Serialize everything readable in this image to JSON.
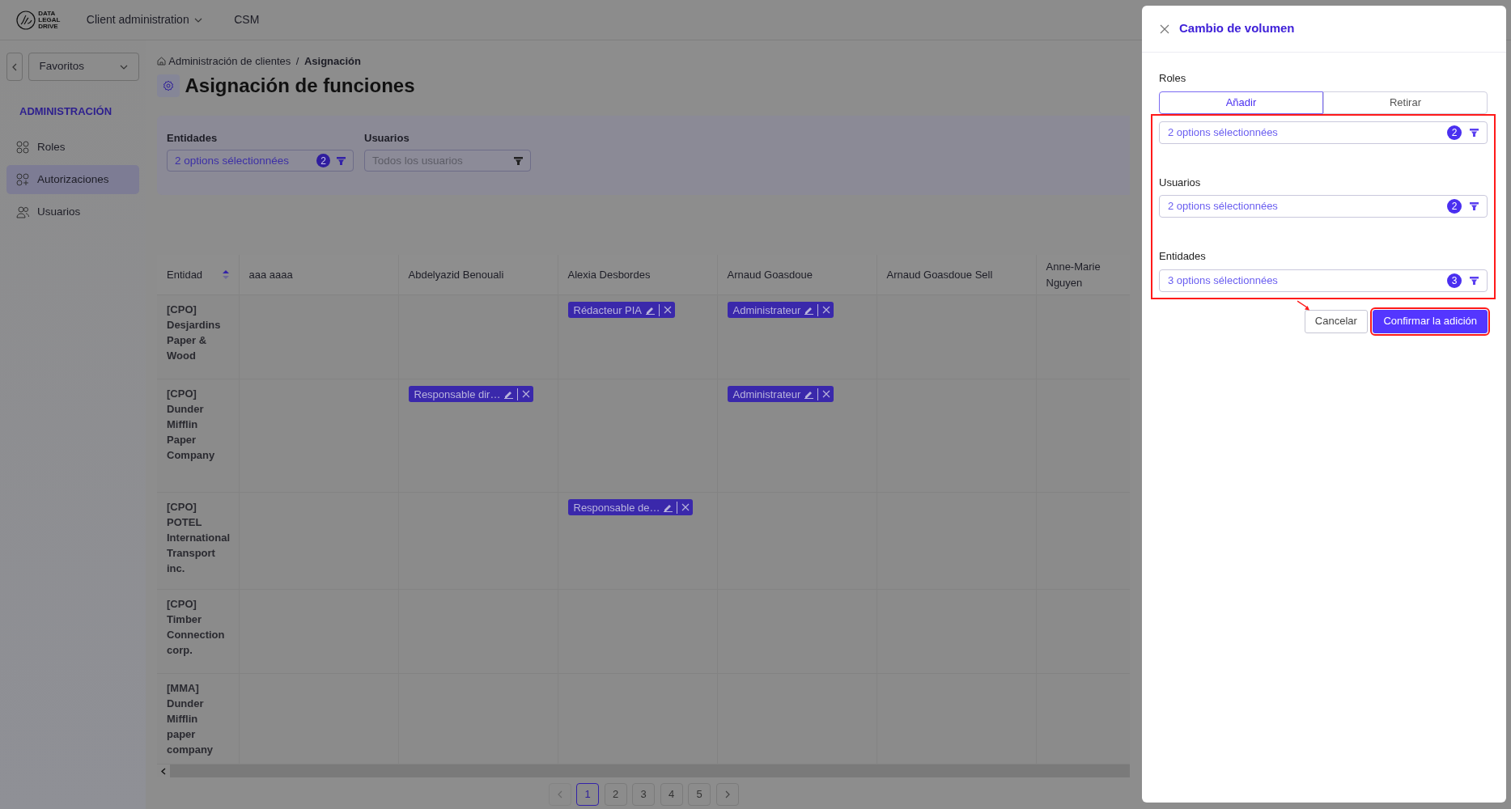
{
  "topbar": {
    "logo_lines": [
      "DATA",
      "LEGAL",
      "DRIVE"
    ],
    "menu": [
      {
        "label": "Client administration",
        "dropdown": true
      },
      {
        "label": "CSM",
        "dropdown": false
      }
    ]
  },
  "sidebar": {
    "favorites": "Favoritos",
    "section": "ADMINISTRACIÓN",
    "items": [
      {
        "label": "Roles",
        "selected": false
      },
      {
        "label": "Autorizaciones",
        "selected": true
      },
      {
        "label": "Usuarios",
        "selected": false
      }
    ]
  },
  "breadcrumb": {
    "items": [
      "Administración de clientes",
      "Asignación"
    ],
    "separator": "/"
  },
  "page_title": "Asignación de funciones",
  "filters": [
    {
      "label": "Entidades",
      "value": "2 options sélectionnées",
      "count": "2"
    },
    {
      "label": "Usuarios",
      "placeholder": "Todos los usuarios"
    }
  ],
  "table": {
    "columns": [
      {
        "label": "Entidad",
        "sortable": true
      },
      {
        "label": "aaa aaaa",
        "sortable": false
      },
      {
        "label": "Abdelyazid Benouali",
        "sortable": false
      },
      {
        "label": "Alexia Desbordes",
        "sortable": false
      },
      {
        "label": "Arnaud Goasdoue",
        "sortable": false
      },
      {
        "label": "Arnaud Goasdoue Sell",
        "sortable": false
      },
      {
        "label": "Anne-Marie Nguyen",
        "sortable": false
      }
    ],
    "rows": [
      {
        "cells": [
          "[CPO] Desjardins Paper & Wood",
          "",
          "",
          "Rédacteur PIA",
          "Administrateur",
          "",
          ""
        ]
      },
      {
        "cells": [
          "[CPO] Dunder Mifflin Paper Company",
          "",
          "Responsable dir…",
          "",
          "Administrateur",
          "",
          ""
        ]
      },
      {
        "cells": [
          "[CPO] POTEL International Transport inc.",
          "",
          "",
          "Responsable de…",
          "",
          "",
          ""
        ]
      },
      {
        "cells": [
          "[CPO] Timber Connection corp.",
          "",
          "",
          "",
          "",
          "",
          ""
        ]
      },
      {
        "cells": [
          "[MMA] Dunder Mifflin paper company",
          "",
          "",
          "",
          "",
          "",
          ""
        ]
      }
    ]
  },
  "pagination": {
    "prev_disabled": true,
    "pages": [
      {
        "label": "1",
        "selected": true
      },
      {
        "label": "2",
        "selected": false
      },
      {
        "label": "3",
        "selected": false
      },
      {
        "label": "4",
        "selected": false
      },
      {
        "label": "5",
        "selected": false
      }
    ]
  },
  "panel": {
    "title": "Cambio de volumen",
    "roles_label": "Roles",
    "modes": [
      {
        "label": "Añadir",
        "selected": true
      },
      {
        "label": "Retirar",
        "selected": false
      }
    ],
    "fields_highlighted": true,
    "fields": [
      {
        "value": "2 options sélectionnées",
        "count": "2"
      },
      {
        "label": "Usuarios",
        "value": "2 options sélectionnées",
        "count": "2"
      },
      {
        "label": "Entidades",
        "value": "3 options sélectionnées",
        "count": "3"
      }
    ],
    "buttons": [
      {
        "label": "Cancelar",
        "kind": "secondary",
        "highlighted": false
      },
      {
        "label": "Confirmar la adición",
        "kind": "primary",
        "highlighted": true
      }
    ]
  }
}
